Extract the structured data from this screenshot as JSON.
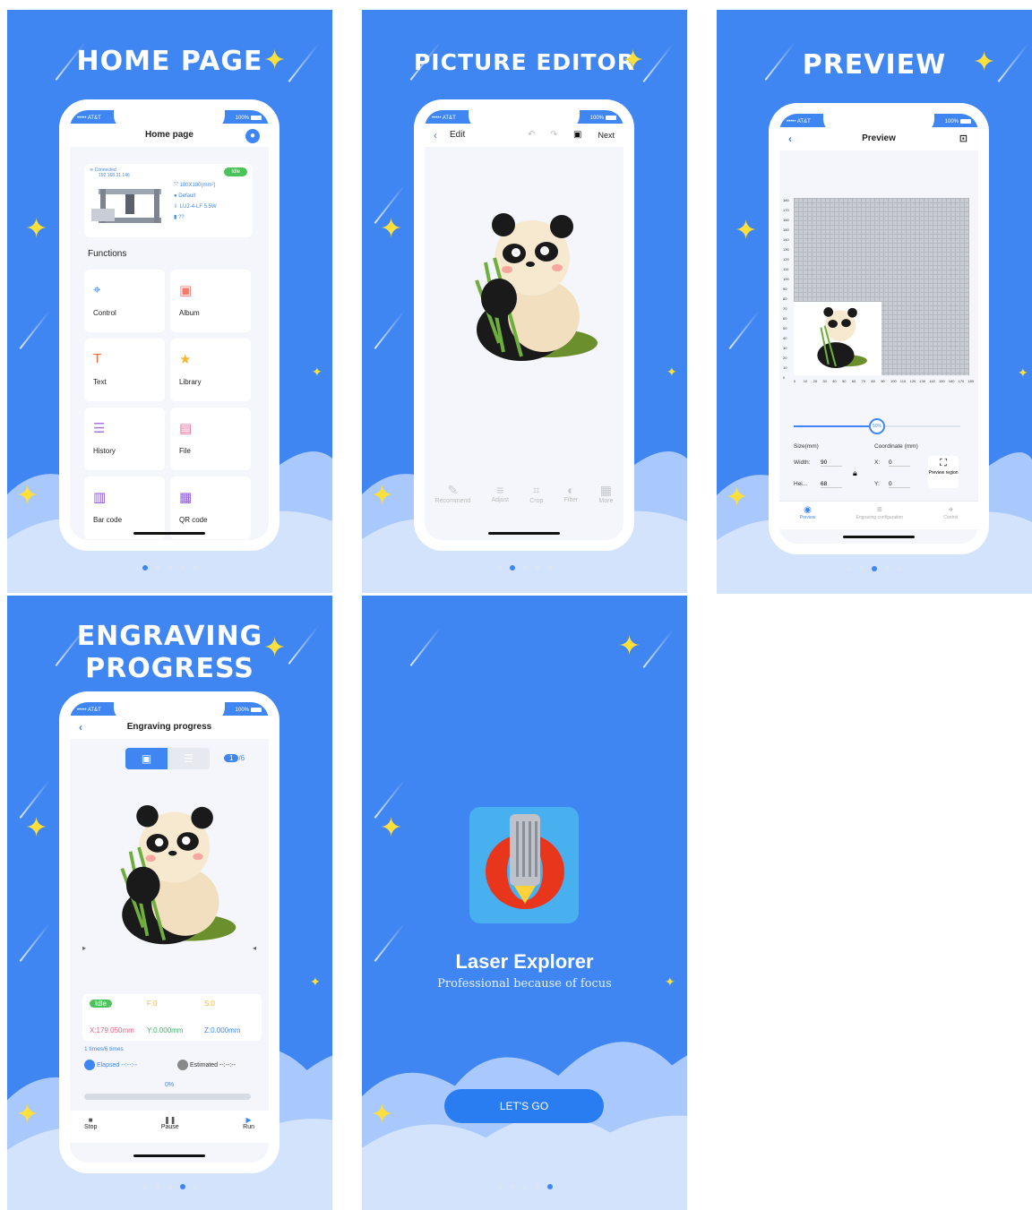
{
  "slides": {
    "home": {
      "title": "HOME PAGE",
      "status_left": "••••• AT&T",
      "status_right": "100%",
      "nav_title": "Home page",
      "device": {
        "connected": "Connected",
        "ip": "192.168.31.146",
        "status": "Idle",
        "size": "180X180(mm²)",
        "profile": "Default",
        "laser": "LU2-4-LF 5.5W",
        "unknown": "??"
      },
      "functions_label": "Functions",
      "functions": [
        {
          "label": "Control",
          "icon": "crosshair-icon"
        },
        {
          "label": "Album",
          "icon": "image-icon"
        },
        {
          "label": "Text",
          "icon": "text-icon"
        },
        {
          "label": "Library",
          "icon": "star-icon"
        },
        {
          "label": "History",
          "icon": "list-icon"
        },
        {
          "label": "File",
          "icon": "file-icon"
        },
        {
          "label": "Bar code",
          "icon": "barcode-icon"
        },
        {
          "label": "QR code",
          "icon": "qrcode-icon"
        }
      ]
    },
    "editor": {
      "title": "PICTURE EDITOR",
      "status_left": "••••• AT&T",
      "status_right": "100%",
      "nav_title": "Edit",
      "next": "Next",
      "tools": [
        "Recommend",
        "Adjust",
        "Crop",
        "Filter",
        "More"
      ]
    },
    "preview": {
      "title": "PREVIEW",
      "status_left": "••••• AT&T",
      "status_right": "100%",
      "nav_title": "Preview",
      "y_ticks": [
        "180",
        "170",
        "160",
        "150",
        "140",
        "130",
        "120",
        "110",
        "100",
        "90",
        "80",
        "70",
        "60",
        "50",
        "40",
        "30",
        "20",
        "10",
        "0"
      ],
      "x_ticks": [
        "0",
        "10",
        "20",
        "30",
        "40",
        "50",
        "60",
        "70",
        "80",
        "90",
        "100",
        "110",
        "120",
        "130",
        "140",
        "150",
        "160",
        "170",
        "180"
      ],
      "slider_value": "50%",
      "size_label": "Size(mm)",
      "coord_label": "Coordinate (mm)",
      "width_label": "Width:",
      "width_value": "90",
      "height_label": "Hei...",
      "height_value": "68",
      "x_label": "X:",
      "x_value": "0",
      "y_label": "Y:",
      "y_value": "0",
      "preview_region": "Preview region",
      "tabs": [
        "Preview",
        "Engraving configuration",
        "Control"
      ]
    },
    "progress": {
      "title_line1": "ENGRAVING",
      "title_line2": "PROGRESS",
      "status_left": "••••• AT&T",
      "status_right": "100%",
      "nav_title": "Engraving progress",
      "page_current": "1",
      "page_total": "/6",
      "state": "Idle",
      "f": "F:0",
      "s": "S:0",
      "x": "X:179.050mm",
      "y": "Y:0.000mm",
      "z": "Z:0.000mm",
      "times": "1 times/6 times",
      "elapsed": "Elapsed --:--:--",
      "estimated": "Estimated --:--:--",
      "percent": "0%",
      "progress": 0,
      "controls": [
        "Stop",
        "Pause",
        "Run"
      ]
    },
    "splash": {
      "app_name": "Laser Explorer",
      "tagline": "Professional because of focus",
      "cta": "LET'S GO"
    }
  },
  "colors": {
    "brand": "#3f86f2",
    "idle": "#4cc25a",
    "star": "#ffe03a"
  }
}
